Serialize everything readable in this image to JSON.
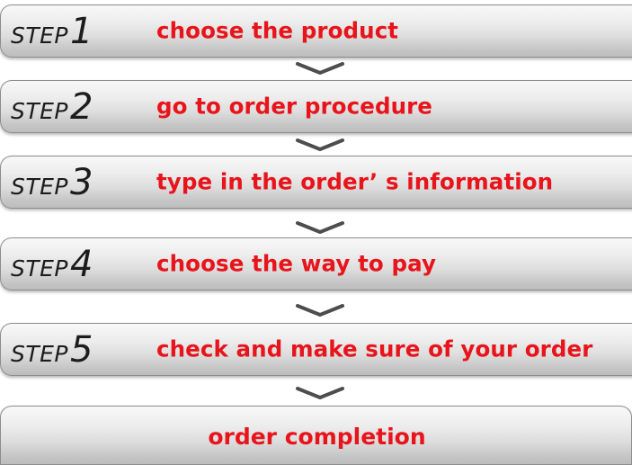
{
  "steps": [
    {
      "tag": "STEP",
      "number": "1",
      "text": "choose the product"
    },
    {
      "tag": "STEP",
      "number": "2",
      "text": "go to order procedure"
    },
    {
      "tag": "STEP",
      "number": "3",
      "text": "type in the order’ s information"
    },
    {
      "tag": "STEP",
      "number": "4",
      "text": "choose the way to pay"
    },
    {
      "tag": "STEP",
      "number": "5",
      "text": "check and make sure of your order"
    }
  ],
  "final": {
    "text": "order completion"
  },
  "connector_icon": "chevron-down-icon",
  "colors": {
    "step_text": "#e8141b",
    "step_label": "#1c1c1c",
    "bar_light": "#f8f8f8",
    "bar_dark": "#bdbdbd",
    "bar_border": "#8d8d8d",
    "chevron": "#4d4d4d"
  }
}
